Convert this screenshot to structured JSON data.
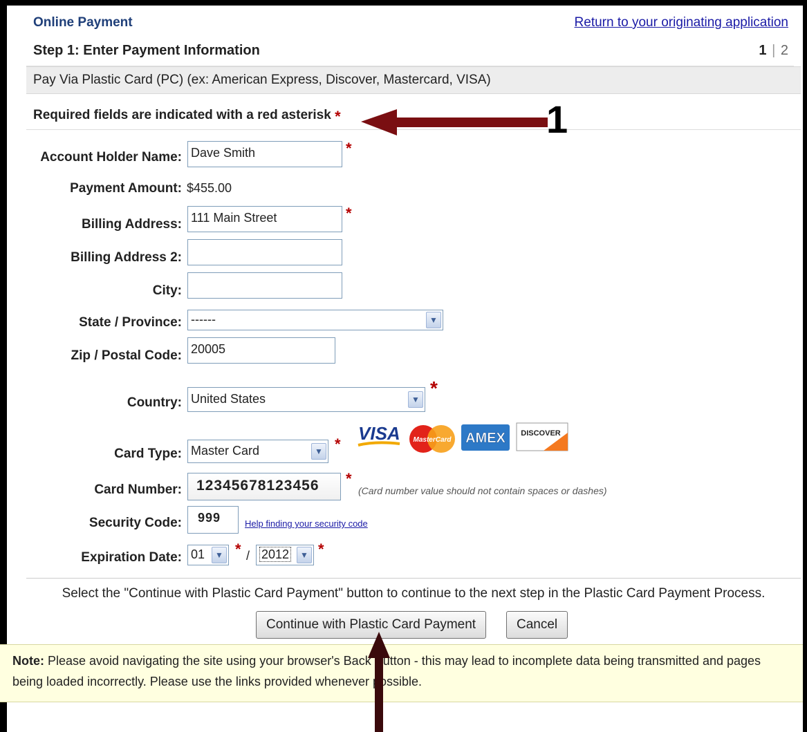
{
  "header": {
    "title": "Online Payment",
    "return_link": "Return to your originating application"
  },
  "step": {
    "title": "Step 1: Enter Payment Information",
    "current": "1",
    "separator": "|",
    "other": "2"
  },
  "pay_via": "Pay Via Plastic Card (PC) (ex: American Express, Discover, Mastercard, VISA)",
  "required_note": "Required fields are indicated with a red asterisk",
  "asterisk": "*",
  "form": {
    "account_holder_label": "Account Holder Name:",
    "account_holder_value": "Dave Smith",
    "payment_amount_label": "Payment Amount:",
    "payment_amount_value": "$455.00",
    "billing_address_label": "Billing Address:",
    "billing_address_value": "111 Main Street",
    "billing_address2_label": "Billing Address 2:",
    "billing_address2_value": "",
    "city_label": "City:",
    "city_value": "",
    "state_label": "State / Province:",
    "state_value": "------",
    "zip_label": "Zip / Postal Code:",
    "zip_value": "20005",
    "country_label": "Country:",
    "country_value": "United States",
    "card_type_label": "Card Type:",
    "card_type_value": "Master Card",
    "card_number_label": "Card Number:",
    "card_number_value": "12345678123456",
    "card_number_hint": "(Card number value should not contain spaces or dashes)",
    "security_code_label": "Security Code:",
    "security_code_value": "999",
    "security_help_link": "Help finding your security code",
    "expiration_label": "Expiration Date:",
    "expiration_month": "01",
    "expiration_slash": "/",
    "expiration_year": "2012"
  },
  "card_logos": {
    "visa": "VISA",
    "mastercard": "MasterCard",
    "amex": "AMEX",
    "discover": "DISCOVER"
  },
  "instructions": "Select the \"Continue with Plastic Card Payment\" button to continue to the next step in the Plastic Card Payment Process.",
  "buttons": {
    "continue": "Continue with Plastic Card Payment",
    "cancel": "Cancel"
  },
  "note": {
    "label": "Note:",
    "text": " Please avoid navigating the site using your browser's Back Button - this may lead to incomplete data being transmitted and pages being loaded incorrectly. Please use the links provided whenever possible."
  },
  "annotations": {
    "number_1": "1"
  },
  "colors": {
    "title_blue": "#1f3f79",
    "link_blue": "#1a1aa6",
    "required_red": "#b40000",
    "arrow_red": "#7a0f12",
    "note_bg": "#ffffe0"
  }
}
